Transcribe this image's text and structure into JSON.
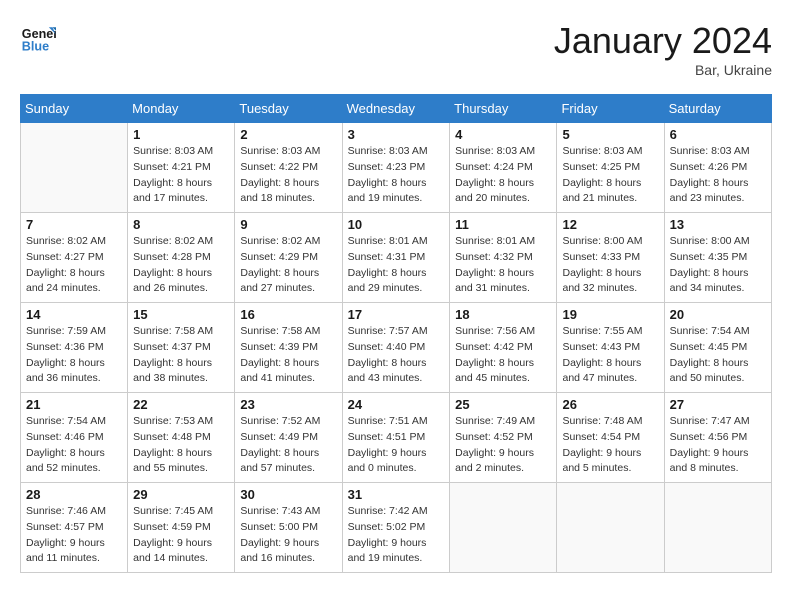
{
  "header": {
    "logo_line1": "General",
    "logo_line2": "Blue",
    "month": "January 2024",
    "location": "Bar, Ukraine"
  },
  "weekdays": [
    "Sunday",
    "Monday",
    "Tuesday",
    "Wednesday",
    "Thursday",
    "Friday",
    "Saturday"
  ],
  "weeks": [
    [
      {
        "day": "",
        "info": ""
      },
      {
        "day": "1",
        "info": "Sunrise: 8:03 AM\nSunset: 4:21 PM\nDaylight: 8 hours\nand 17 minutes."
      },
      {
        "day": "2",
        "info": "Sunrise: 8:03 AM\nSunset: 4:22 PM\nDaylight: 8 hours\nand 18 minutes."
      },
      {
        "day": "3",
        "info": "Sunrise: 8:03 AM\nSunset: 4:23 PM\nDaylight: 8 hours\nand 19 minutes."
      },
      {
        "day": "4",
        "info": "Sunrise: 8:03 AM\nSunset: 4:24 PM\nDaylight: 8 hours\nand 20 minutes."
      },
      {
        "day": "5",
        "info": "Sunrise: 8:03 AM\nSunset: 4:25 PM\nDaylight: 8 hours\nand 21 minutes."
      },
      {
        "day": "6",
        "info": "Sunrise: 8:03 AM\nSunset: 4:26 PM\nDaylight: 8 hours\nand 23 minutes."
      }
    ],
    [
      {
        "day": "7",
        "info": ""
      },
      {
        "day": "8",
        "info": "Sunrise: 8:02 AM\nSunset: 4:28 PM\nDaylight: 8 hours\nand 26 minutes."
      },
      {
        "day": "9",
        "info": "Sunrise: 8:02 AM\nSunset: 4:29 PM\nDaylight: 8 hours\nand 27 minutes."
      },
      {
        "day": "10",
        "info": "Sunrise: 8:01 AM\nSunset: 4:31 PM\nDaylight: 8 hours\nand 29 minutes."
      },
      {
        "day": "11",
        "info": "Sunrise: 8:01 AM\nSunset: 4:32 PM\nDaylight: 8 hours\nand 31 minutes."
      },
      {
        "day": "12",
        "info": "Sunrise: 8:00 AM\nSunset: 4:33 PM\nDaylight: 8 hours\nand 32 minutes."
      },
      {
        "day": "13",
        "info": "Sunrise: 8:00 AM\nSunset: 4:35 PM\nDaylight: 8 hours\nand 34 minutes."
      }
    ],
    [
      {
        "day": "14",
        "info": ""
      },
      {
        "day": "15",
        "info": "Sunrise: 7:58 AM\nSunset: 4:37 PM\nDaylight: 8 hours\nand 38 minutes."
      },
      {
        "day": "16",
        "info": "Sunrise: 7:58 AM\nSunset: 4:39 PM\nDaylight: 8 hours\nand 41 minutes."
      },
      {
        "day": "17",
        "info": "Sunrise: 7:57 AM\nSunset: 4:40 PM\nDaylight: 8 hours\nand 43 minutes."
      },
      {
        "day": "18",
        "info": "Sunrise: 7:56 AM\nSunset: 4:42 PM\nDaylight: 8 hours\nand 45 minutes."
      },
      {
        "day": "19",
        "info": "Sunrise: 7:55 AM\nSunset: 4:43 PM\nDaylight: 8 hours\nand 47 minutes."
      },
      {
        "day": "20",
        "info": "Sunrise: 7:54 AM\nSunset: 4:45 PM\nDaylight: 8 hours\nand 50 minutes."
      }
    ],
    [
      {
        "day": "21",
        "info": ""
      },
      {
        "day": "22",
        "info": "Sunrise: 7:53 AM\nSunset: 4:48 PM\nDaylight: 8 hours\nand 55 minutes."
      },
      {
        "day": "23",
        "info": "Sunrise: 7:52 AM\nSunset: 4:49 PM\nDaylight: 8 hours\nand 57 minutes."
      },
      {
        "day": "24",
        "info": "Sunrise: 7:51 AM\nSunset: 4:51 PM\nDaylight: 9 hours\nand 0 minutes."
      },
      {
        "day": "25",
        "info": "Sunrise: 7:49 AM\nSunset: 4:52 PM\nDaylight: 9 hours\nand 2 minutes."
      },
      {
        "day": "26",
        "info": "Sunrise: 7:48 AM\nSunset: 4:54 PM\nDaylight: 9 hours\nand 5 minutes."
      },
      {
        "day": "27",
        "info": "Sunrise: 7:47 AM\nSunset: 4:56 PM\nDaylight: 9 hours\nand 8 minutes."
      }
    ],
    [
      {
        "day": "28",
        "info": "Sunrise: 7:46 AM\nSunset: 4:57 PM\nDaylight: 9 hours\nand 11 minutes."
      },
      {
        "day": "29",
        "info": "Sunrise: 7:45 AM\nSunset: 4:59 PM\nDaylight: 9 hours\nand 14 minutes."
      },
      {
        "day": "30",
        "info": "Sunrise: 7:43 AM\nSunset: 5:00 PM\nDaylight: 9 hours\nand 16 minutes."
      },
      {
        "day": "31",
        "info": "Sunrise: 7:42 AM\nSunset: 5:02 PM\nDaylight: 9 hours\nand 19 minutes."
      },
      {
        "day": "",
        "info": ""
      },
      {
        "day": "",
        "info": ""
      },
      {
        "day": "",
        "info": ""
      }
    ]
  ],
  "week1_sunday": "Sunrise: 8:02 AM\nSunset: 4:27 PM\nDaylight: 8 hours\nand 24 minutes.",
  "week2_sunday": "Sunrise: 7:59 AM\nSunset: 4:36 PM\nDaylight: 8 hours\nand 36 minutes.",
  "week3_sunday": "Sunrise: 7:54 AM\nSunset: 4:46 PM\nDaylight: 8 hours\nand 52 minutes."
}
